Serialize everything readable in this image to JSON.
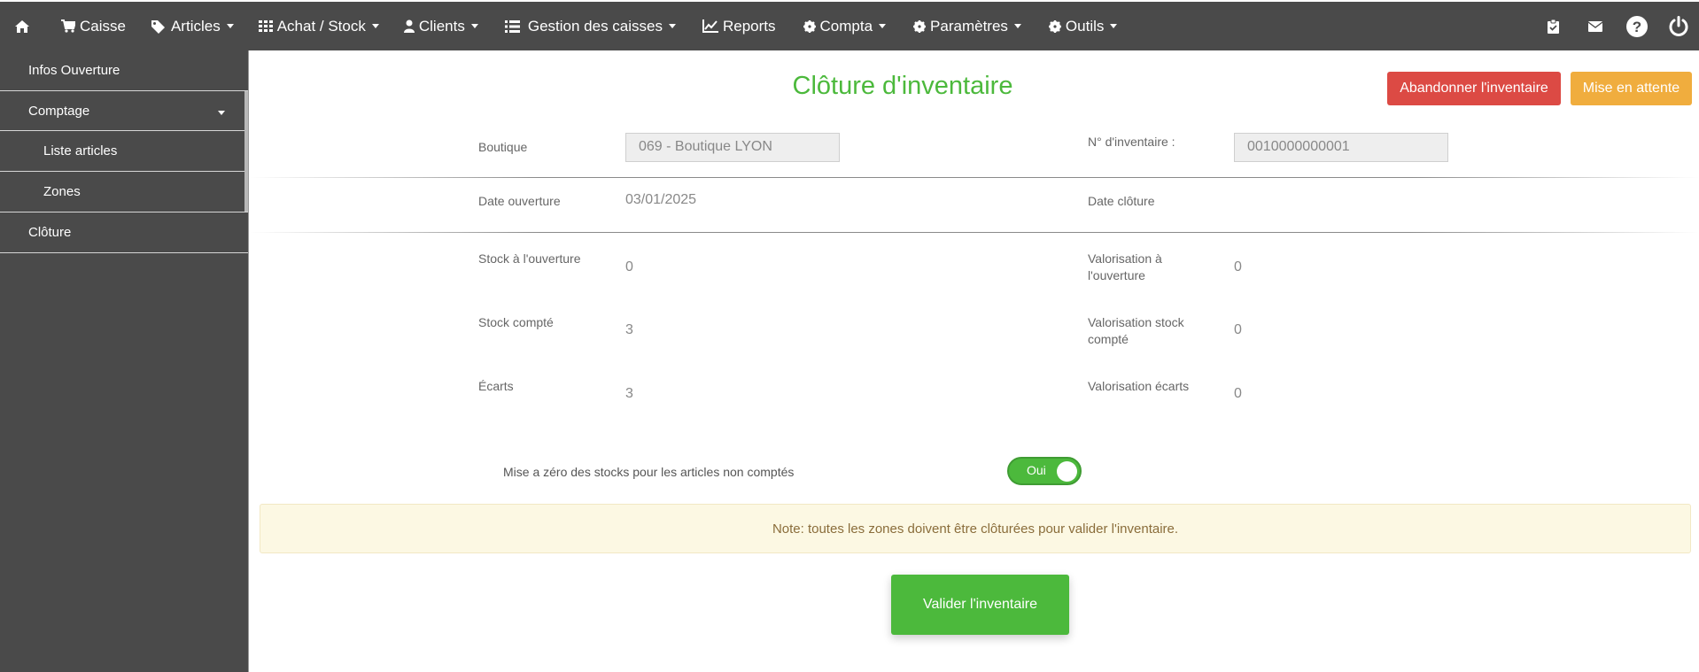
{
  "nav": {
    "items": [
      {
        "label": "",
        "icon": "home-icon"
      },
      {
        "label": "Caisse",
        "icon": "cart-icon"
      },
      {
        "label": "Articles",
        "icon": "tags-icon"
      },
      {
        "label": "Achat / Stock",
        "icon": "grid-icon"
      },
      {
        "label": "Clients",
        "icon": "user-icon"
      },
      {
        "label": "Gestion des caisses",
        "icon": "list-icon"
      },
      {
        "label": "Reports",
        "icon": "line-chart-icon"
      },
      {
        "label": "Compta",
        "icon": "gear-icon"
      },
      {
        "label": "Paramètres",
        "icon": "gear-icon"
      },
      {
        "label": "Outils",
        "icon": "gear-icon"
      }
    ],
    "right_icons": [
      "clipboard-check-icon",
      "envelope-icon",
      "help-icon",
      "power-icon"
    ]
  },
  "sidebar": {
    "items": [
      {
        "label": "Infos Ouverture"
      },
      {
        "label": "Comptage"
      },
      {
        "label": "Liste articles"
      },
      {
        "label": "Zones"
      },
      {
        "label": "Clôture"
      }
    ]
  },
  "page": {
    "title": "Clôture d'inventaire",
    "abandon_label": "Abandonner l'inventaire",
    "hold_label": "Mise en attente",
    "boutique_label": "Boutique",
    "boutique_value": "069 - Boutique LYON",
    "inventory_no_label": "N° d'inventaire :",
    "inventory_no_value": "0010000000001",
    "date_open_label": "Date ouverture",
    "date_open_value": "03/01/2025",
    "date_close_label": "Date clôture",
    "stock_open_label": "Stock à l'ouverture",
    "stock_open_value": "0",
    "valo_open_label_1": "Valorisation à",
    "valo_open_label_2": "l'ouverture",
    "valo_open_value": "0",
    "stock_counted_label": "Stock compté",
    "stock_counted_value": "3",
    "valo_counted_label_1": "Valorisation stock",
    "valo_counted_label_2": "compté",
    "valo_counted_value": "0",
    "gaps_label": "Écarts",
    "gaps_value": "3",
    "valo_gaps_label": "Valorisation écarts",
    "valo_gaps_value": "0",
    "reset_label": "Mise a zéro des stocks pour les articles non comptés",
    "reset_toggle": "Oui",
    "note": "Note: toutes les zones doivent être clôturées pour valider l'inventaire.",
    "validate_label": "Valider l'inventaire"
  },
  "colors": {
    "nav_bg": "#4a4a4a",
    "accent_green": "#4cb93c",
    "danger": "#dc4a44",
    "warning": "#f0ad3e",
    "note_bg": "#fcf8e3"
  }
}
